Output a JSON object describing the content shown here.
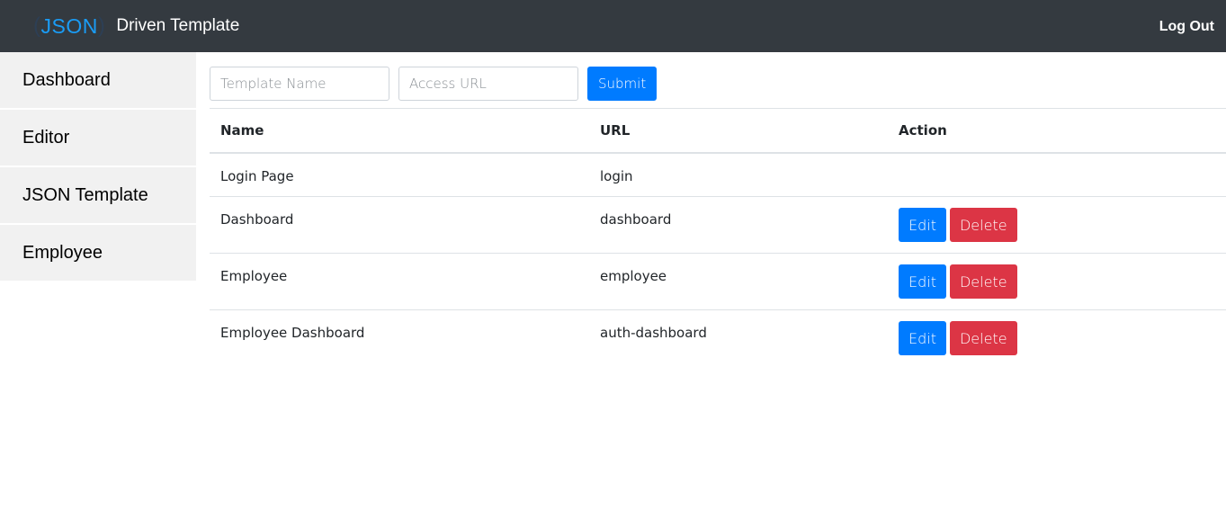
{
  "header": {
    "logo_text": "JSON",
    "title": "Driven Template",
    "logout_label": "Log Out"
  },
  "sidebar": {
    "items": [
      {
        "label": "Dashboard"
      },
      {
        "label": "Editor"
      },
      {
        "label": "JSON Template"
      },
      {
        "label": "Employee"
      }
    ]
  },
  "form": {
    "template_name_placeholder": "Template Name",
    "access_url_placeholder": "Access URL",
    "submit_label": "Submit"
  },
  "table": {
    "headers": [
      "Name",
      "URL",
      "Action"
    ],
    "rows": [
      {
        "name": "Login Page",
        "url": "login",
        "edit_label": "",
        "delete_label": ""
      },
      {
        "name": "Dashboard",
        "url": "dashboard",
        "edit_label": "Edit",
        "delete_label": "Delete"
      },
      {
        "name": "Employee",
        "url": "employee",
        "edit_label": "Edit",
        "delete_label": "Delete"
      },
      {
        "name": "Employee Dashboard",
        "url": "auth-dashboard",
        "edit_label": "Edit",
        "delete_label": "Delete"
      }
    ]
  },
  "colors": {
    "header_bg": "#343a40",
    "primary": "#007bff",
    "danger": "#dc3545",
    "sidebar_bg": "#f1f1f1"
  }
}
